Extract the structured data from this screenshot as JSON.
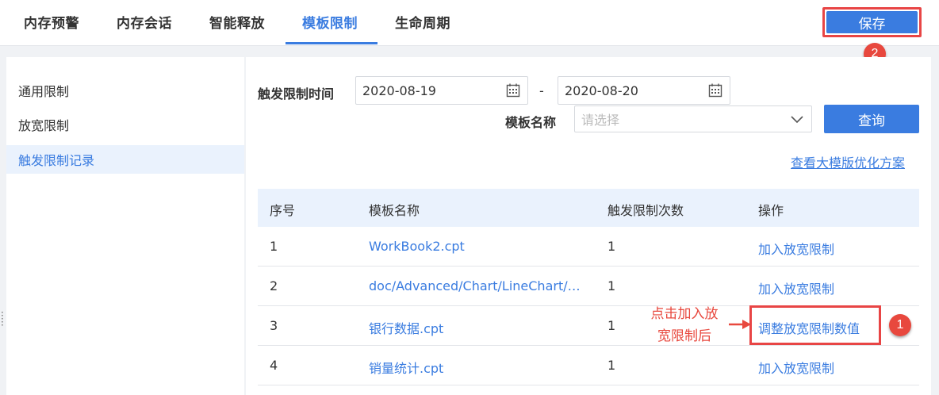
{
  "tabs": [
    {
      "label": "内存预警",
      "active": false
    },
    {
      "label": "内存会话",
      "active": false
    },
    {
      "label": "智能释放",
      "active": false
    },
    {
      "label": "模板限制",
      "active": true
    },
    {
      "label": "生命周期",
      "active": false
    }
  ],
  "save_label": "保存",
  "annotations": {
    "badge_save": "2",
    "badge_adjust": "1",
    "note_lines": [
      "点击加入放",
      "宽限制后"
    ]
  },
  "sidebar": {
    "items": [
      {
        "label": "通用限制",
        "active": false
      },
      {
        "label": "放宽限制",
        "active": false
      },
      {
        "label": "触发限制记录",
        "active": true
      }
    ]
  },
  "filter": {
    "time_label": "触发限制时间",
    "start_date": "2020-08-19",
    "separator": "-",
    "end_date": "2020-08-20",
    "template_label": "模板名称",
    "template_placeholder": "请选择",
    "query_label": "查询",
    "plan_link": "查看大模版优化方案"
  },
  "table": {
    "headers": [
      "序号",
      "模板名称",
      "触发限制次数",
      "操作"
    ],
    "rows": [
      {
        "index": "1",
        "name": "WorkBook2.cpt",
        "count": "1",
        "action": "加入放宽限制"
      },
      {
        "index": "2",
        "name": "doc/Advanced/Chart/LineChart/…",
        "count": "1",
        "action": "加入放宽限制"
      },
      {
        "index": "3",
        "name": "银行数据.cpt",
        "count": "1",
        "action": "调整放宽限制数值"
      },
      {
        "index": "4",
        "name": "销量统计.cpt",
        "count": "1",
        "action": "加入放宽限制"
      }
    ]
  },
  "colors": {
    "accent": "#3a7ce0",
    "annotation_red": "#e8483e",
    "header_bg": "#eaf2fd"
  }
}
